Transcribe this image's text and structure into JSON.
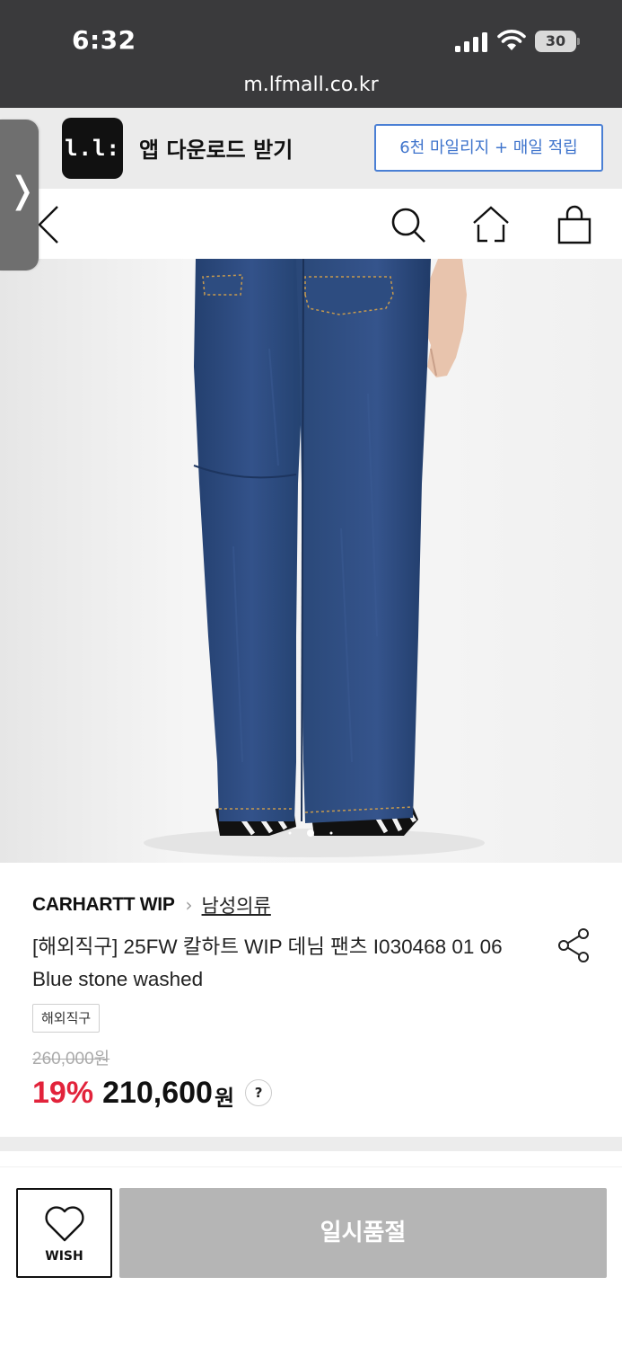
{
  "status_bar": {
    "time": "6:32",
    "battery": "30",
    "url": "m.lfmall.co.kr"
  },
  "app_banner": {
    "logo_text": "l.l:",
    "text": "앱 다운로드 받기",
    "button_label": "6천 마일리지 + 매일 적립"
  },
  "side_tab": {
    "icon": "chevron-right"
  },
  "header": {
    "back_icon": "back-arrow",
    "icons": [
      "search-icon",
      "home-icon",
      "shopping-bag-icon"
    ]
  },
  "product_image": {
    "carousel_dots_count": 3,
    "active_dot_index": 1
  },
  "product": {
    "brand": "CARHARTT WIP",
    "category": "남성의류",
    "title": "[해외직구] 25FW 칼하트 WIP 데님 팬츠 I030468 01 06 Blue stone washed",
    "tag": "해외직구",
    "original_price": "260,000원",
    "discount": "19%",
    "price": "210,600",
    "price_unit": "원",
    "help": "?"
  },
  "bottom_bar": {
    "wish_label": "WISH",
    "soldout_label": "일시품절"
  },
  "colors": {
    "status_bar_bg": "#3a3a3c",
    "accent_blue": "#3f74cc",
    "discount_red": "#e2233b",
    "soldout_gray": "#b5b5b5",
    "denim": "#2d4a7c"
  }
}
